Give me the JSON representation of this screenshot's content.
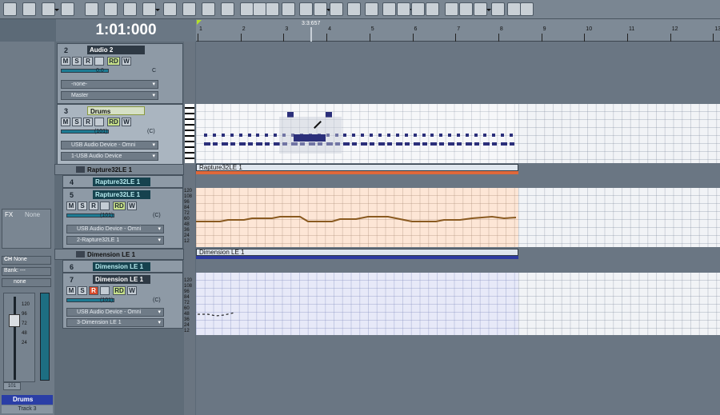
{
  "clock": {
    "time": "1:01:000"
  },
  "ruler": {
    "now_time": "3:3:657",
    "bars": [
      "1",
      "2",
      "3",
      "4",
      "5",
      "6",
      "7",
      "8",
      "9",
      "10",
      "11",
      "12",
      "13"
    ]
  },
  "left_panel": {
    "fx_tab": "FX",
    "fx_none": "None",
    "ch_label": "CH",
    "ch_value": "None",
    "bank_label": "Bank:",
    "bank_value": "---",
    "patch_value": "none",
    "fader_scale": [
      "120",
      "96",
      "72",
      "48",
      "24"
    ],
    "fader_value": "101",
    "strip_name": "Drums",
    "strip_sub": "Track 3"
  },
  "tracks": [
    {
      "num": "2",
      "name": "Audio 2",
      "vol": "0.0",
      "pan": "C",
      "input": "-none-",
      "output": "Master"
    },
    {
      "num": "3",
      "name": "Drums",
      "vol": "(101)",
      "pan": "(C)",
      "input": "USB Audio Device - Omni",
      "output": "1-USB Audio Device"
    },
    {
      "folder": "Rapture32LE 1"
    },
    {
      "num": "4",
      "name": "Rapture32LE 1"
    },
    {
      "num": "5",
      "name": "Rapture32LE 1",
      "vol": "(101)",
      "pan": "(C)",
      "input": "USB Audio Device - Omni",
      "output": "2-Rapture32LE 1"
    },
    {
      "folder": "Dimension LE 1"
    },
    {
      "num": "6",
      "name": "Dimension LE 1"
    },
    {
      "num": "7",
      "name": "Dimension LE 1",
      "vol": "(101)",
      "pan": "(C)",
      "input": "USB Audio Device - Omni",
      "output": "3-Dimension LE 1"
    }
  ],
  "buttons": {
    "m": "M",
    "s": "S",
    "r": "R",
    "rd": "RD",
    "w": "W"
  },
  "meter_scale": [
    "-3",
    "-6",
    "-9",
    "dB",
    "-9",
    "-6",
    "-3"
  ],
  "clips": {
    "rapture_header": "Rapture32LE 1",
    "dimension_header": "Dimension LE 1",
    "scale": [
      "120",
      "108",
      "96",
      "84",
      "72",
      "60",
      "48",
      "36",
      "24",
      "12"
    ]
  },
  "colors": {
    "accent": "#1d7c94",
    "rapture_clip": "#e0683a",
    "dimension_clip": "#2d3aa0",
    "note": "#2b2f7a"
  }
}
